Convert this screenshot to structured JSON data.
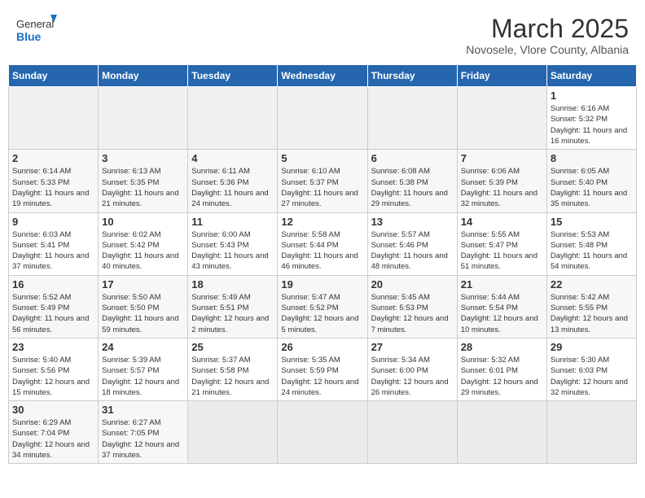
{
  "header": {
    "logo_general": "General",
    "logo_blue": "Blue",
    "month": "March 2025",
    "location": "Novosele, Vlore County, Albania"
  },
  "days_of_week": [
    "Sunday",
    "Monday",
    "Tuesday",
    "Wednesday",
    "Thursday",
    "Friday",
    "Saturday"
  ],
  "weeks": [
    [
      {
        "day": "",
        "empty": true
      },
      {
        "day": "",
        "empty": true
      },
      {
        "day": "",
        "empty": true
      },
      {
        "day": "",
        "empty": true
      },
      {
        "day": "",
        "empty": true
      },
      {
        "day": "",
        "empty": true
      },
      {
        "day": "1",
        "sunrise": "Sunrise: 6:16 AM",
        "sunset": "Sunset: 5:32 PM",
        "daylight": "Daylight: 11 hours and 16 minutes."
      }
    ],
    [
      {
        "day": "2",
        "sunrise": "Sunrise: 6:14 AM",
        "sunset": "Sunset: 5:33 PM",
        "daylight": "Daylight: 11 hours and 19 minutes."
      },
      {
        "day": "3",
        "sunrise": "Sunrise: 6:13 AM",
        "sunset": "Sunset: 5:35 PM",
        "daylight": "Daylight: 11 hours and 21 minutes."
      },
      {
        "day": "4",
        "sunrise": "Sunrise: 6:11 AM",
        "sunset": "Sunset: 5:36 PM",
        "daylight": "Daylight: 11 hours and 24 minutes."
      },
      {
        "day": "5",
        "sunrise": "Sunrise: 6:10 AM",
        "sunset": "Sunset: 5:37 PM",
        "daylight": "Daylight: 11 hours and 27 minutes."
      },
      {
        "day": "6",
        "sunrise": "Sunrise: 6:08 AM",
        "sunset": "Sunset: 5:38 PM",
        "daylight": "Daylight: 11 hours and 29 minutes."
      },
      {
        "day": "7",
        "sunrise": "Sunrise: 6:06 AM",
        "sunset": "Sunset: 5:39 PM",
        "daylight": "Daylight: 11 hours and 32 minutes."
      },
      {
        "day": "8",
        "sunrise": "Sunrise: 6:05 AM",
        "sunset": "Sunset: 5:40 PM",
        "daylight": "Daylight: 11 hours and 35 minutes."
      }
    ],
    [
      {
        "day": "9",
        "sunrise": "Sunrise: 6:03 AM",
        "sunset": "Sunset: 5:41 PM",
        "daylight": "Daylight: 11 hours and 37 minutes."
      },
      {
        "day": "10",
        "sunrise": "Sunrise: 6:02 AM",
        "sunset": "Sunset: 5:42 PM",
        "daylight": "Daylight: 11 hours and 40 minutes."
      },
      {
        "day": "11",
        "sunrise": "Sunrise: 6:00 AM",
        "sunset": "Sunset: 5:43 PM",
        "daylight": "Daylight: 11 hours and 43 minutes."
      },
      {
        "day": "12",
        "sunrise": "Sunrise: 5:58 AM",
        "sunset": "Sunset: 5:44 PM",
        "daylight": "Daylight: 11 hours and 46 minutes."
      },
      {
        "day": "13",
        "sunrise": "Sunrise: 5:57 AM",
        "sunset": "Sunset: 5:46 PM",
        "daylight": "Daylight: 11 hours and 48 minutes."
      },
      {
        "day": "14",
        "sunrise": "Sunrise: 5:55 AM",
        "sunset": "Sunset: 5:47 PM",
        "daylight": "Daylight: 11 hours and 51 minutes."
      },
      {
        "day": "15",
        "sunrise": "Sunrise: 5:53 AM",
        "sunset": "Sunset: 5:48 PM",
        "daylight": "Daylight: 11 hours and 54 minutes."
      }
    ],
    [
      {
        "day": "16",
        "sunrise": "Sunrise: 5:52 AM",
        "sunset": "Sunset: 5:49 PM",
        "daylight": "Daylight: 11 hours and 56 minutes."
      },
      {
        "day": "17",
        "sunrise": "Sunrise: 5:50 AM",
        "sunset": "Sunset: 5:50 PM",
        "daylight": "Daylight: 11 hours and 59 minutes."
      },
      {
        "day": "18",
        "sunrise": "Sunrise: 5:49 AM",
        "sunset": "Sunset: 5:51 PM",
        "daylight": "Daylight: 12 hours and 2 minutes."
      },
      {
        "day": "19",
        "sunrise": "Sunrise: 5:47 AM",
        "sunset": "Sunset: 5:52 PM",
        "daylight": "Daylight: 12 hours and 5 minutes."
      },
      {
        "day": "20",
        "sunrise": "Sunrise: 5:45 AM",
        "sunset": "Sunset: 5:53 PM",
        "daylight": "Daylight: 12 hours and 7 minutes."
      },
      {
        "day": "21",
        "sunrise": "Sunrise: 5:44 AM",
        "sunset": "Sunset: 5:54 PM",
        "daylight": "Daylight: 12 hours and 10 minutes."
      },
      {
        "day": "22",
        "sunrise": "Sunrise: 5:42 AM",
        "sunset": "Sunset: 5:55 PM",
        "daylight": "Daylight: 12 hours and 13 minutes."
      }
    ],
    [
      {
        "day": "23",
        "sunrise": "Sunrise: 5:40 AM",
        "sunset": "Sunset: 5:56 PM",
        "daylight": "Daylight: 12 hours and 15 minutes."
      },
      {
        "day": "24",
        "sunrise": "Sunrise: 5:39 AM",
        "sunset": "Sunset: 5:57 PM",
        "daylight": "Daylight: 12 hours and 18 minutes."
      },
      {
        "day": "25",
        "sunrise": "Sunrise: 5:37 AM",
        "sunset": "Sunset: 5:58 PM",
        "daylight": "Daylight: 12 hours and 21 minutes."
      },
      {
        "day": "26",
        "sunrise": "Sunrise: 5:35 AM",
        "sunset": "Sunset: 5:59 PM",
        "daylight": "Daylight: 12 hours and 24 minutes."
      },
      {
        "day": "27",
        "sunrise": "Sunrise: 5:34 AM",
        "sunset": "Sunset: 6:00 PM",
        "daylight": "Daylight: 12 hours and 26 minutes."
      },
      {
        "day": "28",
        "sunrise": "Sunrise: 5:32 AM",
        "sunset": "Sunset: 6:01 PM",
        "daylight": "Daylight: 12 hours and 29 minutes."
      },
      {
        "day": "29",
        "sunrise": "Sunrise: 5:30 AM",
        "sunset": "Sunset: 6:03 PM",
        "daylight": "Daylight: 12 hours and 32 minutes."
      }
    ],
    [
      {
        "day": "30",
        "sunrise": "Sunrise: 6:29 AM",
        "sunset": "Sunset: 7:04 PM",
        "daylight": "Daylight: 12 hours and 34 minutes."
      },
      {
        "day": "31",
        "sunrise": "Sunrise: 6:27 AM",
        "sunset": "Sunset: 7:05 PM",
        "daylight": "Daylight: 12 hours and 37 minutes."
      },
      {
        "day": "",
        "empty": true
      },
      {
        "day": "",
        "empty": true
      },
      {
        "day": "",
        "empty": true
      },
      {
        "day": "",
        "empty": true
      },
      {
        "day": "",
        "empty": true
      }
    ]
  ]
}
